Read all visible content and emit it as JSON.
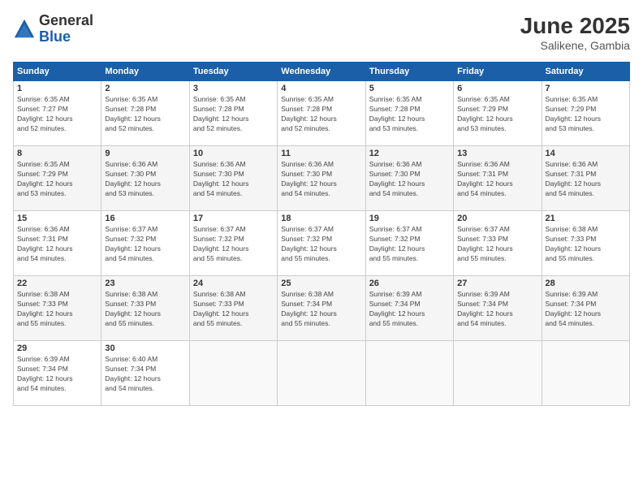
{
  "logo": {
    "general": "General",
    "blue": "Blue"
  },
  "title": "June 2025",
  "location": "Salikene, Gambia",
  "days_of_week": [
    "Sunday",
    "Monday",
    "Tuesday",
    "Wednesday",
    "Thursday",
    "Friday",
    "Saturday"
  ],
  "weeks": [
    [
      {
        "day": "1",
        "info": "Sunrise: 6:35 AM\nSunset: 7:27 PM\nDaylight: 12 hours\nand 52 minutes."
      },
      {
        "day": "2",
        "info": "Sunrise: 6:35 AM\nSunset: 7:28 PM\nDaylight: 12 hours\nand 52 minutes."
      },
      {
        "day": "3",
        "info": "Sunrise: 6:35 AM\nSunset: 7:28 PM\nDaylight: 12 hours\nand 52 minutes."
      },
      {
        "day": "4",
        "info": "Sunrise: 6:35 AM\nSunset: 7:28 PM\nDaylight: 12 hours\nand 52 minutes."
      },
      {
        "day": "5",
        "info": "Sunrise: 6:35 AM\nSunset: 7:28 PM\nDaylight: 12 hours\nand 53 minutes."
      },
      {
        "day": "6",
        "info": "Sunrise: 6:35 AM\nSunset: 7:29 PM\nDaylight: 12 hours\nand 53 minutes."
      },
      {
        "day": "7",
        "info": "Sunrise: 6:35 AM\nSunset: 7:29 PM\nDaylight: 12 hours\nand 53 minutes."
      }
    ],
    [
      {
        "day": "8",
        "info": "Sunrise: 6:35 AM\nSunset: 7:29 PM\nDaylight: 12 hours\nand 53 minutes."
      },
      {
        "day": "9",
        "info": "Sunrise: 6:36 AM\nSunset: 7:30 PM\nDaylight: 12 hours\nand 53 minutes."
      },
      {
        "day": "10",
        "info": "Sunrise: 6:36 AM\nSunset: 7:30 PM\nDaylight: 12 hours\nand 54 minutes."
      },
      {
        "day": "11",
        "info": "Sunrise: 6:36 AM\nSunset: 7:30 PM\nDaylight: 12 hours\nand 54 minutes."
      },
      {
        "day": "12",
        "info": "Sunrise: 6:36 AM\nSunset: 7:30 PM\nDaylight: 12 hours\nand 54 minutes."
      },
      {
        "day": "13",
        "info": "Sunrise: 6:36 AM\nSunset: 7:31 PM\nDaylight: 12 hours\nand 54 minutes."
      },
      {
        "day": "14",
        "info": "Sunrise: 6:36 AM\nSunset: 7:31 PM\nDaylight: 12 hours\nand 54 minutes."
      }
    ],
    [
      {
        "day": "15",
        "info": "Sunrise: 6:36 AM\nSunset: 7:31 PM\nDaylight: 12 hours\nand 54 minutes."
      },
      {
        "day": "16",
        "info": "Sunrise: 6:37 AM\nSunset: 7:32 PM\nDaylight: 12 hours\nand 54 minutes."
      },
      {
        "day": "17",
        "info": "Sunrise: 6:37 AM\nSunset: 7:32 PM\nDaylight: 12 hours\nand 55 minutes."
      },
      {
        "day": "18",
        "info": "Sunrise: 6:37 AM\nSunset: 7:32 PM\nDaylight: 12 hours\nand 55 minutes."
      },
      {
        "day": "19",
        "info": "Sunrise: 6:37 AM\nSunset: 7:32 PM\nDaylight: 12 hours\nand 55 minutes."
      },
      {
        "day": "20",
        "info": "Sunrise: 6:37 AM\nSunset: 7:33 PM\nDaylight: 12 hours\nand 55 minutes."
      },
      {
        "day": "21",
        "info": "Sunrise: 6:38 AM\nSunset: 7:33 PM\nDaylight: 12 hours\nand 55 minutes."
      }
    ],
    [
      {
        "day": "22",
        "info": "Sunrise: 6:38 AM\nSunset: 7:33 PM\nDaylight: 12 hours\nand 55 minutes."
      },
      {
        "day": "23",
        "info": "Sunrise: 6:38 AM\nSunset: 7:33 PM\nDaylight: 12 hours\nand 55 minutes."
      },
      {
        "day": "24",
        "info": "Sunrise: 6:38 AM\nSunset: 7:33 PM\nDaylight: 12 hours\nand 55 minutes."
      },
      {
        "day": "25",
        "info": "Sunrise: 6:38 AM\nSunset: 7:34 PM\nDaylight: 12 hours\nand 55 minutes."
      },
      {
        "day": "26",
        "info": "Sunrise: 6:39 AM\nSunset: 7:34 PM\nDaylight: 12 hours\nand 55 minutes."
      },
      {
        "day": "27",
        "info": "Sunrise: 6:39 AM\nSunset: 7:34 PM\nDaylight: 12 hours\nand 54 minutes."
      },
      {
        "day": "28",
        "info": "Sunrise: 6:39 AM\nSunset: 7:34 PM\nDaylight: 12 hours\nand 54 minutes."
      }
    ],
    [
      {
        "day": "29",
        "info": "Sunrise: 6:39 AM\nSunset: 7:34 PM\nDaylight: 12 hours\nand 54 minutes."
      },
      {
        "day": "30",
        "info": "Sunrise: 6:40 AM\nSunset: 7:34 PM\nDaylight: 12 hours\nand 54 minutes."
      },
      {
        "day": "",
        "info": ""
      },
      {
        "day": "",
        "info": ""
      },
      {
        "day": "",
        "info": ""
      },
      {
        "day": "",
        "info": ""
      },
      {
        "day": "",
        "info": ""
      }
    ]
  ]
}
